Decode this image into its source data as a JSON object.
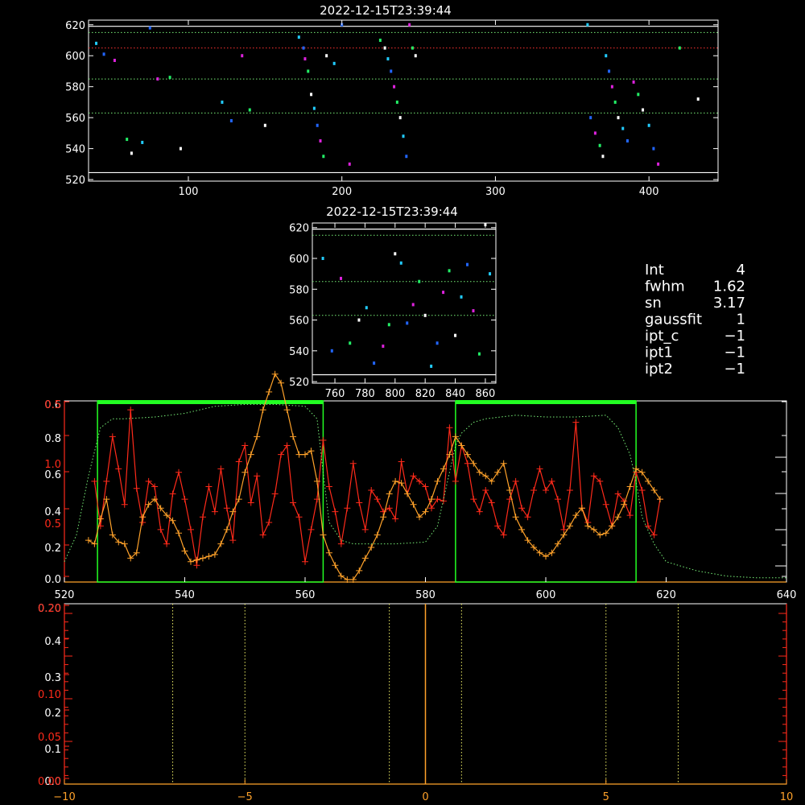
{
  "colors": {
    "background": "#000000",
    "axis": "#ffffff",
    "red": "#ff2a1a",
    "orange": "#ffa22a",
    "green": "#22ff22",
    "green_dotted": "#77ee77",
    "red_axis": "#ff2a1a",
    "marker_cyan": "#22ccff",
    "marker_blue": "#2266ff",
    "marker_magenta": "#dd22dd",
    "marker_green": "#22ee66",
    "marker_white": "#ffffff"
  },
  "info_panel": {
    "rows": [
      {
        "label": "Int",
        "value": "4"
      },
      {
        "label": "fwhm",
        "value": "1.62"
      },
      {
        "label": "sn",
        "value": "3.17"
      },
      {
        "label": "gaussfit",
        "value": "1"
      },
      {
        "label": "ipt_c",
        "value": "-1"
      },
      {
        "label": "ipt1",
        "value": "-1"
      },
      {
        "label": "ipt2",
        "value": "-1"
      }
    ]
  },
  "chart_data": [
    {
      "id": "image-top",
      "type": "scatter",
      "title": "2022-12-15T23:39:44",
      "xlim": [
        35,
        445
      ],
      "ylim": [
        519,
        623
      ],
      "x_ticks": [
        100,
        200,
        300,
        400
      ],
      "y_ticks": [
        520,
        540,
        560,
        580,
        600,
        620
      ],
      "hlines_white": [
        524.5,
        619
      ],
      "hlines_green_dotted": [
        615,
        585,
        563
      ],
      "hlines_red_dotted": [
        605
      ],
      "points": [
        [
          40,
          608
        ],
        [
          45,
          601
        ],
        [
          52,
          597
        ],
        [
          60,
          546
        ],
        [
          63,
          537
        ],
        [
          70,
          544
        ],
        [
          75,
          618
        ],
        [
          80,
          585
        ],
        [
          88,
          586
        ],
        [
          95,
          540
        ],
        [
          122,
          570
        ],
        [
          128,
          558
        ],
        [
          135,
          600
        ],
        [
          140,
          565
        ],
        [
          150,
          555
        ],
        [
          172,
          612
        ],
        [
          175,
          605
        ],
        [
          176,
          598
        ],
        [
          178,
          590
        ],
        [
          180,
          575
        ],
        [
          182,
          566
        ],
        [
          184,
          555
        ],
        [
          186,
          545
        ],
        [
          188,
          535
        ],
        [
          190,
          600
        ],
        [
          195,
          595
        ],
        [
          200,
          620
        ],
        [
          205,
          530
        ],
        [
          225,
          610
        ],
        [
          228,
          605
        ],
        [
          230,
          598
        ],
        [
          232,
          590
        ],
        [
          234,
          580
        ],
        [
          236,
          570
        ],
        [
          238,
          560
        ],
        [
          240,
          548
        ],
        [
          242,
          535
        ],
        [
          244,
          620
        ],
        [
          246,
          605
        ],
        [
          248,
          600
        ],
        [
          360,
          620
        ],
        [
          362,
          560
        ],
        [
          365,
          550
        ],
        [
          368,
          542
        ],
        [
          370,
          535
        ],
        [
          372,
          600
        ],
        [
          374,
          590
        ],
        [
          376,
          580
        ],
        [
          378,
          570
        ],
        [
          380,
          560
        ],
        [
          383,
          553
        ],
        [
          386,
          545
        ],
        [
          390,
          583
        ],
        [
          393,
          575
        ],
        [
          396,
          565
        ],
        [
          400,
          555
        ],
        [
          403,
          540
        ],
        [
          406,
          530
        ],
        [
          420,
          605
        ],
        [
          432,
          572
        ]
      ]
    },
    {
      "id": "image-middle",
      "type": "scatter",
      "title": "2022-12-15T23:39:44",
      "xlim": [
        745,
        867
      ],
      "ylim": [
        519,
        623
      ],
      "x_ticks": [
        760,
        780,
        800,
        820,
        840,
        860
      ],
      "y_ticks": [
        520,
        540,
        560,
        580,
        600,
        620
      ],
      "hlines_white": [
        524.5,
        619
      ],
      "hlines_green_dotted": [
        615,
        585,
        563
      ],
      "points": [
        [
          752,
          600
        ],
        [
          758,
          540
        ],
        [
          764,
          587
        ],
        [
          770,
          545
        ],
        [
          776,
          560
        ],
        [
          781,
          568
        ],
        [
          786,
          532
        ],
        [
          792,
          543
        ],
        [
          796,
          557
        ],
        [
          800,
          603
        ],
        [
          804,
          597
        ],
        [
          808,
          558
        ],
        [
          812,
          570
        ],
        [
          816,
          585
        ],
        [
          820,
          563
        ],
        [
          824,
          530
        ],
        [
          828,
          545
        ],
        [
          832,
          578
        ],
        [
          836,
          592
        ],
        [
          840,
          550
        ],
        [
          844,
          575
        ],
        [
          848,
          596
        ],
        [
          852,
          566
        ],
        [
          856,
          538
        ],
        [
          860,
          622
        ],
        [
          863,
          590
        ]
      ]
    },
    {
      "id": "profile",
      "type": "line",
      "xlim": [
        520,
        640
      ],
      "x_ticks": [
        520,
        540,
        560,
        580,
        600,
        620,
        640
      ],
      "y_ticks_white": [
        "0.0",
        "0.2",
        "0.4",
        "0.6",
        "0.8",
        "0.6"
      ],
      "y_ticks_orange": [
        "0.5",
        "1.0",
        "0.5"
      ],
      "band_lines": [
        525.5,
        563,
        585,
        615
      ],
      "series": [
        {
          "color": "red",
          "x": [
            525,
            526,
            527,
            528,
            529,
            530,
            531,
            532,
            533,
            534,
            535,
            536,
            537,
            538,
            539,
            540,
            541,
            542,
            543,
            544,
            545,
            546,
            547,
            548,
            549,
            550,
            551,
            552,
            553,
            554,
            555,
            556,
            557,
            558,
            559,
            560,
            561,
            562,
            563,
            564,
            565,
            566,
            567,
            568,
            569,
            570,
            571,
            572,
            573,
            574,
            575,
            576,
            577,
            578,
            579,
            580,
            581,
            582,
            583,
            584,
            585,
            586,
            587,
            588,
            589,
            590,
            591,
            592,
            593,
            594,
            595,
            596,
            597,
            598,
            599,
            600,
            601,
            602,
            603,
            604,
            605,
            606,
            607,
            608,
            609,
            610,
            611,
            612,
            613,
            614,
            615,
            616,
            617,
            618,
            619
          ],
          "y": [
            0.55,
            0.3,
            0.55,
            0.8,
            0.62,
            0.42,
            0.95,
            0.51,
            0.32,
            0.55,
            0.52,
            0.28,
            0.2,
            0.48,
            0.6,
            0.45,
            0.28,
            0.08,
            0.35,
            0.52,
            0.38,
            0.62,
            0.4,
            0.22,
            0.66,
            0.75,
            0.43,
            0.58,
            0.25,
            0.32,
            0.48,
            0.7,
            0.75,
            0.43,
            0.35,
            0.1,
            0.28,
            0.45,
            0.78,
            0.52,
            0.38,
            0.2,
            0.4,
            0.65,
            0.43,
            0.28,
            0.5,
            0.45,
            0.38,
            0.4,
            0.34,
            0.66,
            0.48,
            0.58,
            0.55,
            0.52,
            0.4,
            0.45,
            0.44,
            0.85,
            0.55,
            0.75,
            0.65,
            0.45,
            0.38,
            0.5,
            0.43,
            0.3,
            0.25,
            0.45,
            0.55,
            0.4,
            0.35,
            0.5,
            0.62,
            0.5,
            0.55,
            0.45,
            0.28,
            0.5,
            0.88,
            0.4,
            0.32,
            0.58,
            0.55,
            0.42,
            0.3,
            0.48,
            0.44,
            0.36,
            0.6,
            0.5,
            0.3,
            0.25,
            0.45
          ]
        },
        {
          "color": "orange",
          "x": [
            524,
            525,
            526,
            527,
            528,
            529,
            530,
            531,
            532,
            533,
            534,
            535,
            536,
            537,
            538,
            539,
            540,
            541,
            542,
            543,
            544,
            545,
            546,
            547,
            548,
            549,
            550,
            551,
            552,
            553,
            554,
            555,
            556,
            557,
            558,
            559,
            560,
            561,
            562,
            563,
            564,
            565,
            566,
            567,
            568,
            569,
            570,
            571,
            572,
            573,
            574,
            575,
            576,
            577,
            578,
            579,
            580,
            581,
            582,
            583,
            584,
            585,
            586,
            587,
            588,
            589,
            590,
            591,
            592,
            593,
            594,
            595,
            596,
            597,
            598,
            599,
            600,
            601,
            602,
            603,
            604,
            605,
            606,
            607,
            608,
            609,
            610,
            611,
            612,
            613,
            614,
            615,
            616,
            617,
            618,
            619
          ],
          "y": [
            0.22,
            0.2,
            0.34,
            0.45,
            0.25,
            0.21,
            0.2,
            0.12,
            0.15,
            0.35,
            0.42,
            0.45,
            0.4,
            0.36,
            0.33,
            0.26,
            0.16,
            0.1,
            0.11,
            0.12,
            0.13,
            0.14,
            0.2,
            0.28,
            0.38,
            0.45,
            0.6,
            0.7,
            0.8,
            0.95,
            1.05,
            1.15,
            1.1,
            0.95,
            0.8,
            0.7,
            0.7,
            0.72,
            0.55,
            0.25,
            0.15,
            0.08,
            0.02,
            0.0,
            0.0,
            0.05,
            0.12,
            0.18,
            0.25,
            0.35,
            0.48,
            0.55,
            0.54,
            0.48,
            0.42,
            0.35,
            0.38,
            0.45,
            0.55,
            0.62,
            0.7,
            0.8,
            0.75,
            0.7,
            0.65,
            0.6,
            0.58,
            0.55,
            0.6,
            0.65,
            0.5,
            0.35,
            0.28,
            0.22,
            0.18,
            0.15,
            0.13,
            0.15,
            0.2,
            0.25,
            0.3,
            0.36,
            0.4,
            0.3,
            0.28,
            0.25,
            0.26,
            0.3,
            0.35,
            0.42,
            0.52,
            0.62,
            0.6,
            0.55,
            0.5,
            0.45
          ]
        },
        {
          "color": "green_dotted",
          "x": [
            520,
            522,
            524,
            526,
            528,
            530,
            535,
            540,
            545,
            550,
            555,
            560,
            562,
            563,
            564,
            566,
            568,
            570,
            575,
            580,
            582,
            584,
            585,
            586,
            588,
            590,
            595,
            600,
            605,
            610,
            612,
            614,
            615,
            616,
            618,
            620,
            625,
            630,
            635,
            640
          ],
          "y": [
            0.1,
            0.25,
            0.58,
            0.85,
            0.9,
            0.9,
            0.91,
            0.93,
            0.97,
            0.98,
            0.98,
            0.97,
            0.9,
            0.6,
            0.32,
            0.22,
            0.2,
            0.2,
            0.2,
            0.21,
            0.3,
            0.6,
            0.75,
            0.82,
            0.88,
            0.9,
            0.92,
            0.91,
            0.91,
            0.92,
            0.85,
            0.7,
            0.55,
            0.35,
            0.2,
            0.1,
            0.05,
            0.02,
            0.01,
            0.01
          ]
        }
      ]
    },
    {
      "id": "bottom",
      "type": "line",
      "xlim": [
        -10,
        10
      ],
      "x_ticks": [
        -10,
        -5,
        0,
        5,
        10
      ],
      "y_ticks_white": [
        "0.0",
        "0.1",
        "0.2",
        "0.3",
        "0.4",
        "0.20"
      ],
      "y_ticks_orange": [
        "0.00",
        "0.05",
        "0.10",
        "0.20"
      ],
      "vlines_yellow_dotted": [
        -7,
        -5,
        -1,
        1,
        5,
        7
      ],
      "vline_orange": [
        0
      ]
    }
  ]
}
